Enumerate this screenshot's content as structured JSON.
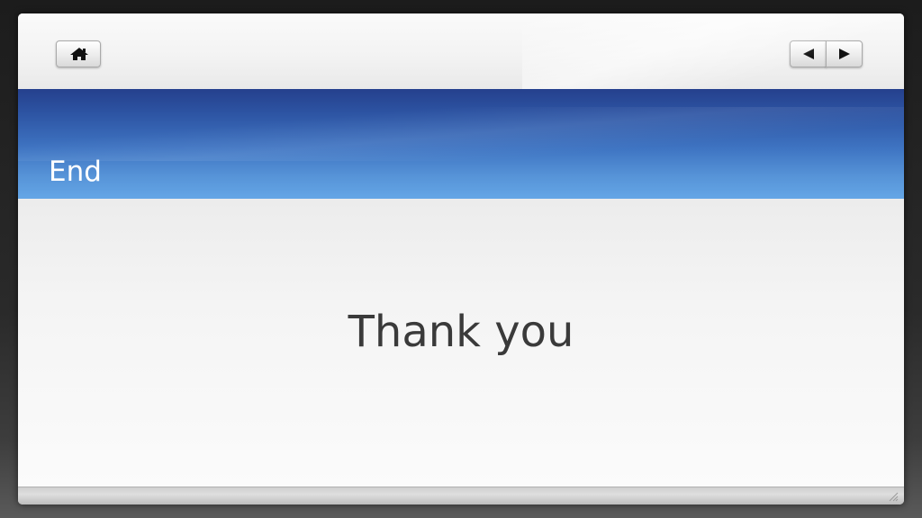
{
  "toolbar": {
    "home_icon": "home-icon",
    "prev_icon": "triangle-left-icon",
    "next_icon": "triangle-right-icon"
  },
  "slide": {
    "title": "End",
    "body": "Thank you"
  },
  "colors": {
    "title_band_dark": "#25408d",
    "title_band_light": "#64a6e6",
    "title_text": "#ffffff",
    "body_text": "#3a3a3a"
  }
}
